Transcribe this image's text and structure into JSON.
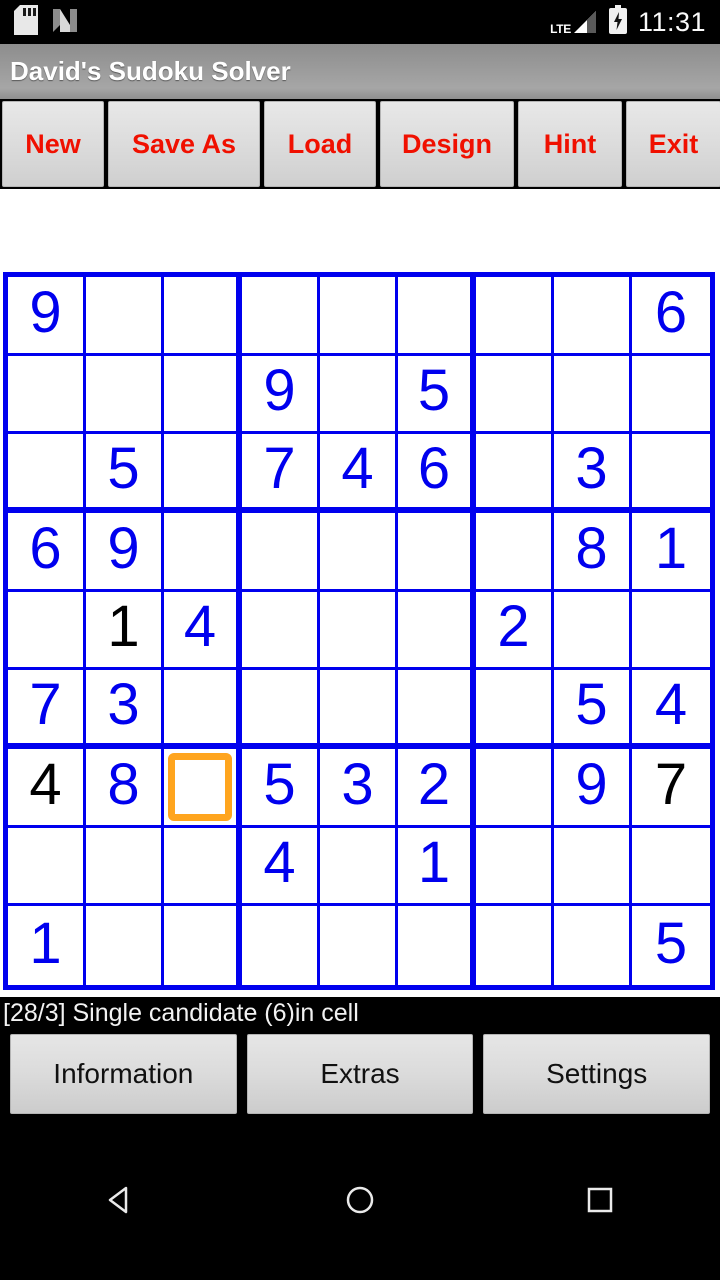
{
  "status_bar": {
    "icons": [
      "sd-card-icon",
      "android-nougat-icon"
    ],
    "network_label": "LTE",
    "network_icon": "signal-bars-icon",
    "battery_icon": "battery-charging-icon",
    "time": "11:31"
  },
  "title_bar": {
    "title": "David's Sudoku Solver"
  },
  "toolbar": {
    "buttons": [
      {
        "label": "New"
      },
      {
        "label": "Save As"
      },
      {
        "label": "Load"
      },
      {
        "label": "Design"
      },
      {
        "label": "Hint"
      },
      {
        "label": "Exit"
      }
    ],
    "text_color": "#f01000"
  },
  "board": {
    "selected_cell": {
      "row": 7,
      "col": 3
    },
    "selection_color": "#ffa51e",
    "given_color": "#0000ee",
    "user_color": "#000000",
    "grid_line_color": "#0000ee",
    "rows": [
      [
        {
          "value": "9",
          "kind": "given"
        },
        {
          "value": "",
          "kind": "empty"
        },
        {
          "value": "",
          "kind": "empty"
        },
        {
          "value": "",
          "kind": "empty"
        },
        {
          "value": "",
          "kind": "empty"
        },
        {
          "value": "",
          "kind": "empty"
        },
        {
          "value": "",
          "kind": "empty"
        },
        {
          "value": "",
          "kind": "empty"
        },
        {
          "value": "6",
          "kind": "given"
        }
      ],
      [
        {
          "value": "",
          "kind": "empty"
        },
        {
          "value": "",
          "kind": "empty"
        },
        {
          "value": "",
          "kind": "empty"
        },
        {
          "value": "9",
          "kind": "given"
        },
        {
          "value": "",
          "kind": "empty"
        },
        {
          "value": "5",
          "kind": "given"
        },
        {
          "value": "",
          "kind": "empty"
        },
        {
          "value": "",
          "kind": "empty"
        },
        {
          "value": "",
          "kind": "empty"
        }
      ],
      [
        {
          "value": "",
          "kind": "empty"
        },
        {
          "value": "5",
          "kind": "given"
        },
        {
          "value": "",
          "kind": "empty"
        },
        {
          "value": "7",
          "kind": "given"
        },
        {
          "value": "4",
          "kind": "given"
        },
        {
          "value": "6",
          "kind": "given"
        },
        {
          "value": "",
          "kind": "empty"
        },
        {
          "value": "3",
          "kind": "given"
        },
        {
          "value": "",
          "kind": "empty"
        }
      ],
      [
        {
          "value": "6",
          "kind": "given"
        },
        {
          "value": "9",
          "kind": "given"
        },
        {
          "value": "",
          "kind": "empty"
        },
        {
          "value": "",
          "kind": "empty"
        },
        {
          "value": "",
          "kind": "empty"
        },
        {
          "value": "",
          "kind": "empty"
        },
        {
          "value": "",
          "kind": "empty"
        },
        {
          "value": "8",
          "kind": "given"
        },
        {
          "value": "1",
          "kind": "given"
        }
      ],
      [
        {
          "value": "",
          "kind": "empty"
        },
        {
          "value": "1",
          "kind": "user"
        },
        {
          "value": "4",
          "kind": "given"
        },
        {
          "value": "",
          "kind": "empty"
        },
        {
          "value": "",
          "kind": "empty"
        },
        {
          "value": "",
          "kind": "empty"
        },
        {
          "value": "2",
          "kind": "given"
        },
        {
          "value": "",
          "kind": "empty"
        },
        {
          "value": "",
          "kind": "empty"
        }
      ],
      [
        {
          "value": "7",
          "kind": "given"
        },
        {
          "value": "3",
          "kind": "given"
        },
        {
          "value": "",
          "kind": "empty"
        },
        {
          "value": "",
          "kind": "empty"
        },
        {
          "value": "",
          "kind": "empty"
        },
        {
          "value": "",
          "kind": "empty"
        },
        {
          "value": "",
          "kind": "empty"
        },
        {
          "value": "5",
          "kind": "given"
        },
        {
          "value": "4",
          "kind": "given"
        }
      ],
      [
        {
          "value": "4",
          "kind": "user"
        },
        {
          "value": "8",
          "kind": "given"
        },
        {
          "value": "",
          "kind": "empty"
        },
        {
          "value": "5",
          "kind": "given"
        },
        {
          "value": "3",
          "kind": "given"
        },
        {
          "value": "2",
          "kind": "given"
        },
        {
          "value": "",
          "kind": "empty"
        },
        {
          "value": "9",
          "kind": "given"
        },
        {
          "value": "7",
          "kind": "user"
        }
      ],
      [
        {
          "value": "",
          "kind": "empty"
        },
        {
          "value": "",
          "kind": "empty"
        },
        {
          "value": "",
          "kind": "empty"
        },
        {
          "value": "4",
          "kind": "given"
        },
        {
          "value": "",
          "kind": "empty"
        },
        {
          "value": "1",
          "kind": "given"
        },
        {
          "value": "",
          "kind": "empty"
        },
        {
          "value": "",
          "kind": "empty"
        },
        {
          "value": "",
          "kind": "empty"
        }
      ],
      [
        {
          "value": "1",
          "kind": "given"
        },
        {
          "value": "",
          "kind": "empty"
        },
        {
          "value": "",
          "kind": "empty"
        },
        {
          "value": "",
          "kind": "empty"
        },
        {
          "value": "",
          "kind": "empty"
        },
        {
          "value": "",
          "kind": "empty"
        },
        {
          "value": "",
          "kind": "empty"
        },
        {
          "value": "",
          "kind": "empty"
        },
        {
          "value": "5",
          "kind": "given"
        }
      ]
    ]
  },
  "status_message": {
    "text": "[28/3] Single candidate (6)in cell"
  },
  "bottom_bar": {
    "buttons": [
      {
        "label": "Information"
      },
      {
        "label": "Extras"
      },
      {
        "label": "Settings"
      }
    ]
  },
  "nav_bar": {
    "icons": [
      "back-icon",
      "home-icon",
      "recents-icon"
    ]
  }
}
